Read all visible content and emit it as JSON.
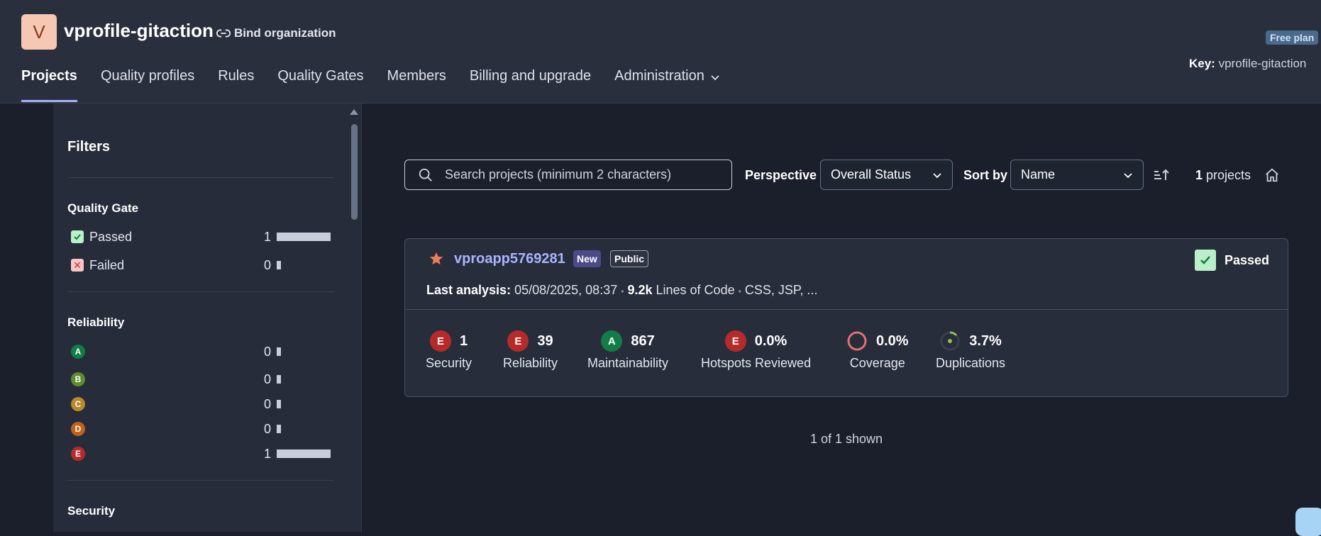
{
  "header": {
    "org_initial": "V",
    "org_name": "vprofile-gitaction",
    "bind_label": "Bind organization",
    "plan_badge": "Free plan",
    "key_label": "Key:",
    "key_value": "vprofile-gitaction"
  },
  "nav": {
    "items": [
      {
        "label": "Projects",
        "active": true
      },
      {
        "label": "Quality profiles"
      },
      {
        "label": "Rules"
      },
      {
        "label": "Quality Gates"
      },
      {
        "label": "Members"
      },
      {
        "label": "Billing and upgrade"
      },
      {
        "label": "Administration",
        "has_dropdown": true
      }
    ]
  },
  "filters": {
    "title": "Filters",
    "quality_gate": {
      "title": "Quality Gate",
      "rows": [
        {
          "label": "Passed",
          "count": "1",
          "fraction": 1.0
        },
        {
          "label": "Failed",
          "count": "0",
          "fraction": 0.0
        }
      ]
    },
    "reliability": {
      "title": "Reliability",
      "rows": [
        {
          "rating": "A",
          "count": "0",
          "fraction": 0.0
        },
        {
          "rating": "B",
          "count": "0",
          "fraction": 0.0
        },
        {
          "rating": "C",
          "count": "0",
          "fraction": 0.0
        },
        {
          "rating": "D",
          "count": "0",
          "fraction": 0.0
        },
        {
          "rating": "E",
          "count": "1",
          "fraction": 1.0
        }
      ]
    },
    "security": {
      "title": "Security"
    }
  },
  "toolbar": {
    "search_placeholder": "Search projects (minimum 2 characters)",
    "perspective_label": "Perspective",
    "perspective_value": "Overall Status",
    "sortby_label": "Sort by",
    "sortby_value": "Name",
    "count_value": "1",
    "count_label": "projects"
  },
  "project": {
    "name": "vproapp5769281",
    "tag_new": "New",
    "tag_public": "Public",
    "status": "Passed",
    "last_analysis_label": "Last analysis:",
    "last_analysis_value": "05/08/2025, 08:37",
    "loc_value": "9.2k",
    "loc_label": "Lines of Code",
    "languages": "CSS, JSP, ...",
    "separator": "•",
    "metrics": {
      "security": {
        "rating": "E",
        "value": "1",
        "label": "Security"
      },
      "reliability": {
        "rating": "E",
        "value": "39",
        "label": "Reliability"
      },
      "maintainability": {
        "rating": "A",
        "value": "867",
        "label": "Maintainability"
      },
      "hotspots": {
        "rating": "E",
        "value": "0.0%",
        "label": "Hotspots Reviewed"
      },
      "coverage": {
        "value": "0.0%",
        "label": "Coverage",
        "fraction": 0.0
      },
      "duplications": {
        "value": "3.7%",
        "label": "Duplications",
        "fraction": 0.037
      }
    }
  },
  "footer": {
    "shown": "1 of 1 shown"
  },
  "colors": {
    "accent": "#a5b0ff",
    "passed": "#b9efc9",
    "failed": "#f7c5c5",
    "rating_A": "#127d47",
    "rating_B": "#5f8c2e",
    "rating_C": "#b7892a",
    "rating_D": "#c0621b",
    "rating_E": "#b72a2a",
    "coverage_ring": "#e3716e",
    "duplications_ring": "#8fbf4d"
  }
}
